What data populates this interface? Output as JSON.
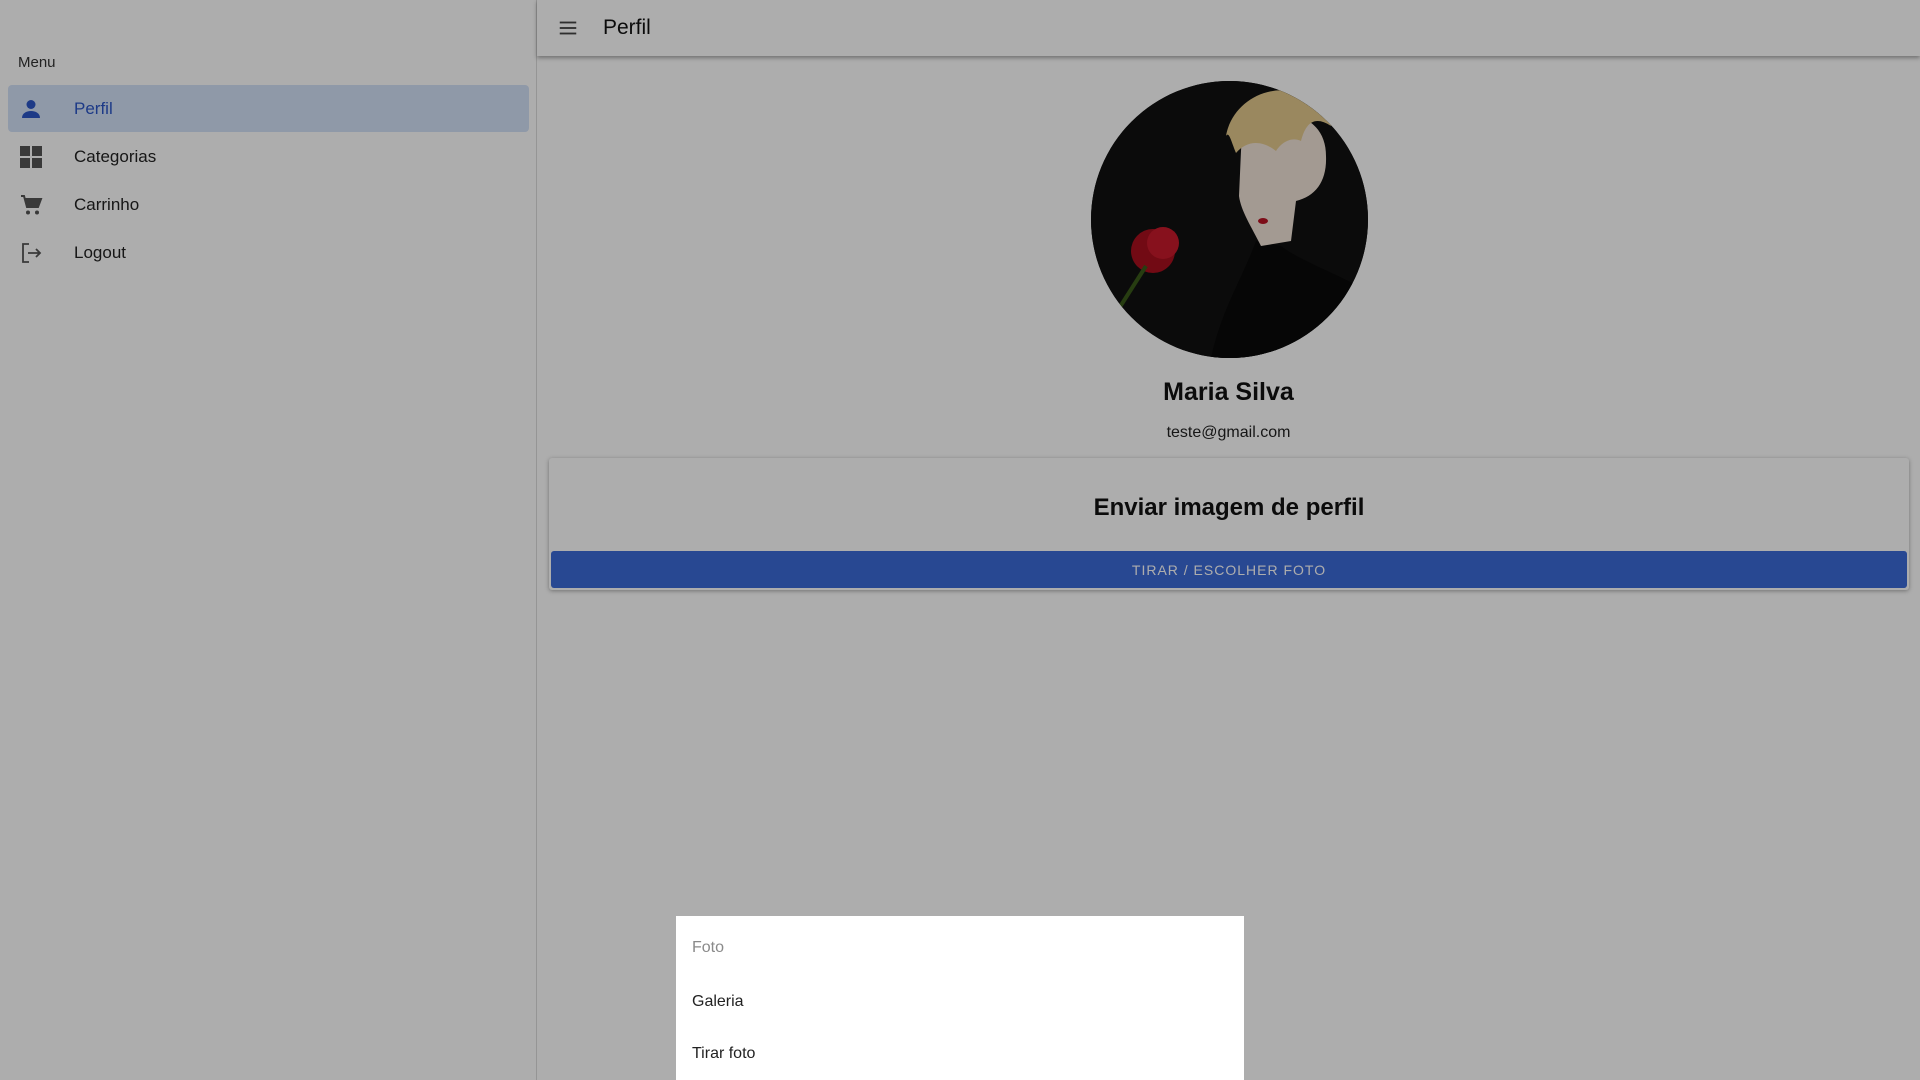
{
  "menu": {
    "title": "Menu",
    "items": [
      {
        "label": "Perfil",
        "icon": "person-icon",
        "active": true
      },
      {
        "label": "Categorias",
        "icon": "grid-icon",
        "active": false
      },
      {
        "label": "Carrinho",
        "icon": "cart-icon",
        "active": false
      },
      {
        "label": "Logout",
        "icon": "logout-icon",
        "active": false
      }
    ]
  },
  "header": {
    "title": "Perfil",
    "menu_icon": "hamburger-icon"
  },
  "profile": {
    "name": "Maria Silva",
    "email": "teste@gmail.com",
    "avatar": "profile-photo"
  },
  "upload": {
    "title": "Enviar imagem de perfil",
    "button_label": "TIRAR / ESCOLHER FOTO"
  },
  "action_sheet": {
    "header": "Foto",
    "options": [
      "Galeria",
      "Tirar foto"
    ]
  },
  "colors": {
    "accent": "#3c6ad8",
    "active_item_bg": "#d3e2f8",
    "active_item_text": "#2b56c8",
    "backdrop": "rgba(0,0,0,0.32)"
  }
}
